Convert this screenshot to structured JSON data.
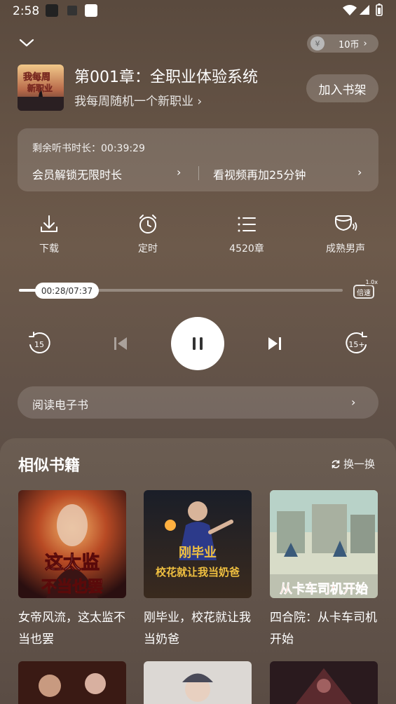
{
  "status_bar": {
    "time": "2:58"
  },
  "header": {
    "coins": "10币",
    "coin_icon_glyph": "¥",
    "chapter_title": "第001章：全职业体验系统",
    "book_title": "我每周随机一个新职业 ›",
    "add_shelf_label": "加入书架",
    "cover_text": "我每周\n新职业"
  },
  "listen_card": {
    "remaining_label": "剩余听书时长：00:39:29",
    "vip_label": "会员解锁无限时长",
    "video_label": "看视频再加25分钟"
  },
  "actions": [
    {
      "label": "下载",
      "icon": "download-icon"
    },
    {
      "label": "定时",
      "icon": "alarm-clock-icon"
    },
    {
      "label": "4520章",
      "icon": "chapter-list-icon"
    },
    {
      "label": "成熟男声",
      "icon": "voice-icon"
    }
  ],
  "progress": {
    "time_label": "00:28/07:37",
    "fraction": 0.061,
    "speed_label": "倍速",
    "speed_value": "1.0x"
  },
  "controls": {
    "rewind_label": "15",
    "forward_label": "15+"
  },
  "read_ebook": {
    "label": "阅读电子书"
  },
  "similar": {
    "title": "相似书籍",
    "refresh_label": "换一换",
    "books": [
      {
        "title": "女帝风流，这太监不当也罢",
        "cover_text": "这太监\n不当也罢"
      },
      {
        "title": "刚毕业，校花就让我当奶爸",
        "cover_text": "刚毕业\n校花就让我当奶爸"
      },
      {
        "title": "四合院：从卡车司机开始",
        "cover_text": "从卡车司机开始"
      }
    ]
  },
  "colors": {
    "background_top": "#5a4a3e",
    "accent_white": "#ffffff"
  }
}
